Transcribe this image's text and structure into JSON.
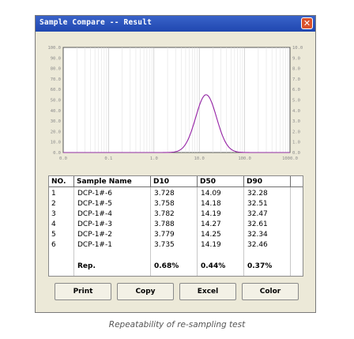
{
  "window": {
    "title": "Sample Compare -- Result",
    "close_glyph": "✕"
  },
  "chart": {
    "left_ticks": [
      "100.0",
      "90.0",
      "80.0",
      "70.0",
      "60.0",
      "50.0",
      "40.0",
      "30.0",
      "20.0",
      "10.0",
      "0.0"
    ],
    "right_ticks": [
      "10.0",
      "9.0",
      "8.0",
      "7.0",
      "6.0",
      "5.0",
      "4.0",
      "3.0",
      "2.0",
      "1.0",
      "0.0"
    ],
    "x_ticks": [
      "0.0",
      "0.1",
      "1.0",
      "10.0",
      "100.0",
      "1000.0"
    ],
    "curve_color": "#c832c8",
    "curve_color_2": "#6a2a8a"
  },
  "table": {
    "headers": [
      "NO.",
      "Sample Name",
      "D10",
      "D50",
      "D90"
    ],
    "rows": [
      {
        "no": "1",
        "name": "DCP-1#-6",
        "d10": "3.728",
        "d50": "14.09",
        "d90": "32.28"
      },
      {
        "no": "2",
        "name": "DCP-1#-5",
        "d10": "3.758",
        "d50": "14.18",
        "d90": "32.51"
      },
      {
        "no": "3",
        "name": "DCP-1#-4",
        "d10": "3.782",
        "d50": "14.19",
        "d90": "32.47"
      },
      {
        "no": "4",
        "name": "DCP-1#-3",
        "d10": "3.788",
        "d50": "14.27",
        "d90": "32.61"
      },
      {
        "no": "5",
        "name": "DCP-1#-2",
        "d10": "3.779",
        "d50": "14.25",
        "d90": "32.34"
      },
      {
        "no": "6",
        "name": "DCP-1#-1",
        "d10": "3.735",
        "d50": "14.19",
        "d90": "32.46"
      }
    ],
    "rep": {
      "name": "Rep.",
      "d10": "0.68%",
      "d50": "0.44%",
      "d90": "0.37%"
    }
  },
  "buttons": {
    "print": "Print",
    "copy": "Copy",
    "excel": "Excel",
    "color": "Color"
  },
  "caption": "Repeatability of re-sampling test"
}
